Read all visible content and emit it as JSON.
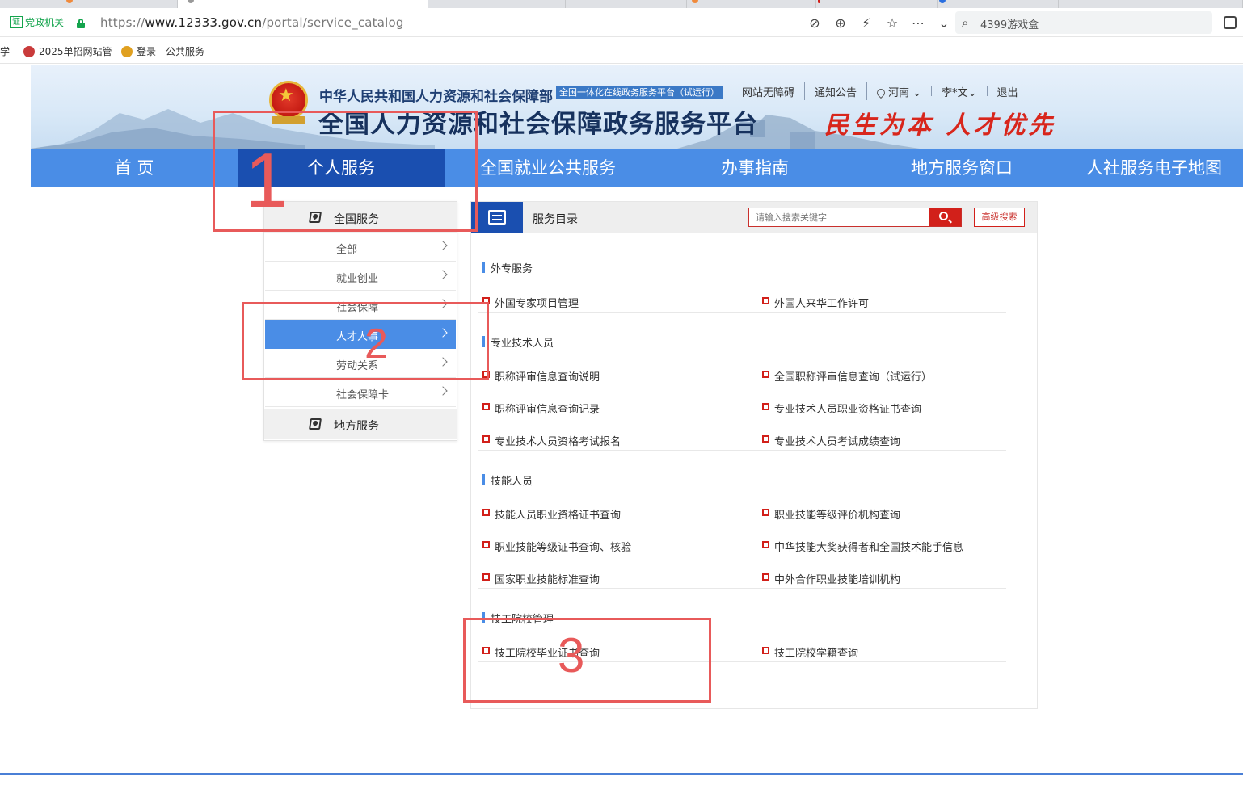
{
  "browser": {
    "cert_label": "党政机关",
    "cert_box": "证",
    "url_prefix": "https://",
    "url_host": "www.12333.gov.cn",
    "url_path": "/portal/service_catalog",
    "search_text": "4399游戏盒",
    "bookmarks": [
      "学",
      "2025单招网站管",
      "登录 - 公共服务"
    ]
  },
  "header": {
    "org_name": "中华人民共和国人力资源和社会保障部",
    "org_tag": "全国一体化在线政务服务平台（试运行）",
    "platform_name": "全国人力资源和社会保障政务服务平台",
    "slogan": "民生为本 人才优先",
    "top_links": {
      "accessibility": "网站无障碍",
      "notice": "通知公告",
      "region": "河南",
      "user": "李*文",
      "logout": "退出"
    }
  },
  "nav": [
    "首 页",
    "个人服务",
    "全国就业公共服务",
    "办事指南",
    "地方服务窗口",
    "人社服务电子地图"
  ],
  "side_menu": {
    "national": "全国服务",
    "items": [
      "全部",
      "就业创业",
      "社会保障",
      "人才人事",
      "劳动关系",
      "社会保障卡"
    ],
    "local": "地方服务"
  },
  "catalog": {
    "title": "服务目录",
    "search_placeholder": "请输入搜索关键字",
    "advanced_search": "高级搜索",
    "sections": [
      {
        "title": "外专服务",
        "items": [
          "外国专家项目管理",
          "外国人来华工作许可"
        ]
      },
      {
        "title": "专业技术人员",
        "items": [
          "职称评审信息查询说明",
          "全国职称评审信息查询（试运行）",
          "职称评审信息查询记录",
          "专业技术人员职业资格证书查询",
          "专业技术人员资格考试报名",
          "专业技术人员考试成绩查询"
        ]
      },
      {
        "title": "技能人员",
        "items": [
          "技能人员职业资格证书查询",
          "职业技能等级评价机构查询",
          "职业技能等级证书查询、核验",
          "中华技能大奖获得者和全国技术能手信息",
          "国家职业技能标准查询",
          "中外合作职业技能培训机构"
        ]
      },
      {
        "title": "技工院校管理",
        "items": [
          "技工院校毕业证书查询",
          "技工院校学籍查询"
        ]
      }
    ]
  },
  "annotations": [
    "1",
    "2",
    "3"
  ],
  "colors": {
    "nav_blue": "#4a8de6",
    "nav_active": "#1a4fb0",
    "accent_red": "#d2201a",
    "annotation": "#e85a5a"
  }
}
